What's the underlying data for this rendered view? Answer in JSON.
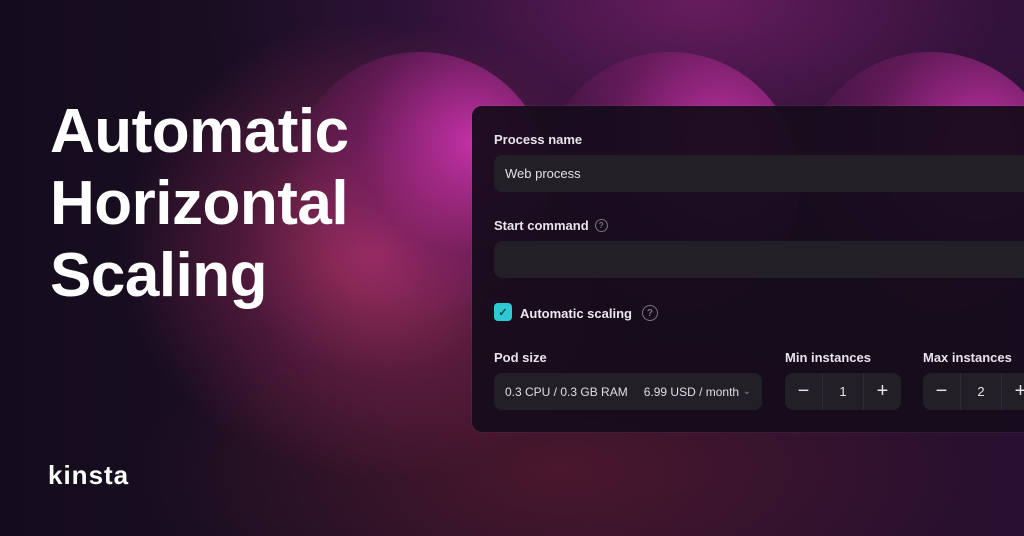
{
  "headline": [
    "Automatic",
    "Horizontal",
    "Scaling"
  ],
  "brand": "kinsta",
  "form": {
    "process_name": {
      "label": "Process name",
      "value": "Web process"
    },
    "start_command": {
      "label": "Start command",
      "value": "",
      "help_icon": "?"
    },
    "automatic_scaling": {
      "label": "Automatic scaling",
      "checked": true,
      "help_icon": "?"
    },
    "pod_size": {
      "label": "Pod size",
      "spec": "0.3 CPU / 0.3 GB RAM",
      "price": "6.99 USD / month"
    },
    "min_instances": {
      "label": "Min instances",
      "value": "1",
      "minus": "−",
      "plus": "+"
    },
    "max_instances": {
      "label": "Max instances",
      "value": "2",
      "minus": "−",
      "plus": "+"
    }
  },
  "icons": {
    "check": "✓",
    "chevron": "⌄"
  },
  "colors": {
    "accent": "#2fc9d3",
    "panel": "#160c1c",
    "field": "#221f27"
  }
}
